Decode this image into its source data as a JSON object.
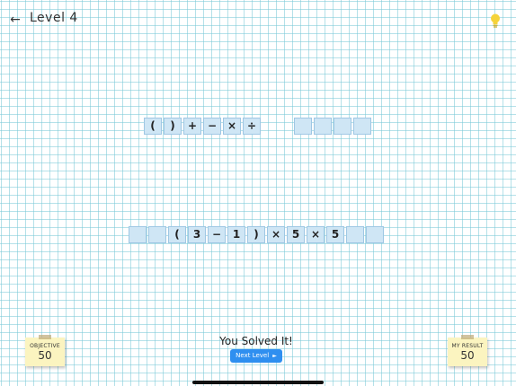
{
  "header": {
    "back_icon": "←",
    "title": "Level  4",
    "hint_icon": "lightbulb-icon"
  },
  "operators": [
    "(",
    ")",
    "+",
    "−",
    "×",
    "÷"
  ],
  "answer": [
    "",
    "",
    "",
    "(",
    "3",
    "−",
    "1",
    ")",
    "×",
    "5",
    "×",
    "5",
    "",
    ""
  ],
  "objective": {
    "label": "OBJECTIVE",
    "value": "50"
  },
  "result": {
    "label": "MY RESULT",
    "value": "50"
  },
  "status": {
    "message": "You Solved It!",
    "next_label": "Next Level",
    "next_arrow": "►"
  },
  "colors": {
    "tile": "#cfe6f5",
    "tile_border": "#9fc7e4",
    "button": "#2f8ff0",
    "note": "#fbf4c0",
    "bulb": "#f5d33a"
  }
}
